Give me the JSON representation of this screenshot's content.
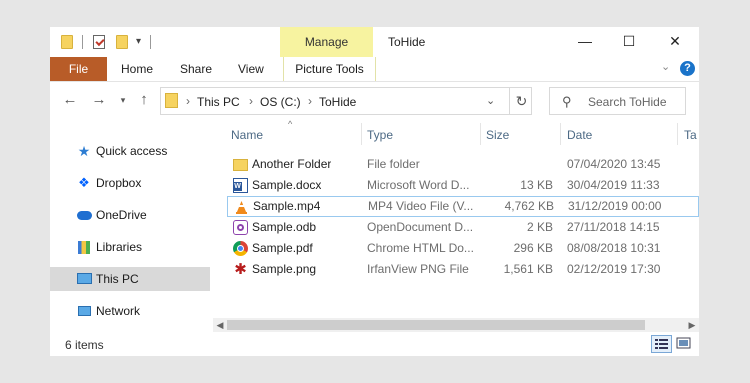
{
  "window": {
    "title": "ToHide"
  },
  "title_bar": {
    "manage_label": "Manage",
    "minimize": "—",
    "maximize": "☐",
    "close": "✕"
  },
  "ribbon": {
    "tabs": [
      {
        "label": "File"
      },
      {
        "label": "Home"
      },
      {
        "label": "Share"
      },
      {
        "label": "View"
      },
      {
        "label": "Picture Tools"
      }
    ],
    "help": "?"
  },
  "address": {
    "segments": [
      "This PC",
      "OS (C:)",
      "ToHide"
    ]
  },
  "search": {
    "placeholder": "Search ToHide"
  },
  "sidebar": {
    "items": [
      {
        "label": "Quick access"
      },
      {
        "label": "Dropbox"
      },
      {
        "label": "OneDrive"
      },
      {
        "label": "Libraries"
      },
      {
        "label": "This PC"
      },
      {
        "label": "Network"
      }
    ]
  },
  "columns": {
    "name": "Name",
    "type": "Type",
    "size": "Size",
    "date": "Date",
    "tags": "Ta"
  },
  "files": [
    {
      "name": "Another Folder",
      "type": "File folder",
      "size": "",
      "date": "07/04/2020 13:45"
    },
    {
      "name": "Sample.docx",
      "type": "Microsoft Word D...",
      "size": "13 KB",
      "date": "30/04/2019 11:33"
    },
    {
      "name": "Sample.mp4",
      "type": "MP4 Video File (V...",
      "size": "4,762 KB",
      "date": "31/12/2019 00:00"
    },
    {
      "name": "Sample.odb",
      "type": "OpenDocument D...",
      "size": "2 KB",
      "date": "27/11/2018 14:15"
    },
    {
      "name": "Sample.pdf",
      "type": "Chrome HTML Do...",
      "size": "296 KB",
      "date": "08/08/2018 10:31"
    },
    {
      "name": "Sample.png",
      "type": "IrfanView PNG File",
      "size": "1,561 KB",
      "date": "02/12/2019 17:30"
    }
  ],
  "status": {
    "item_count": "6 items"
  },
  "colors": {
    "file_tab": "#b85c28",
    "manage_highlight": "#f7f3a0",
    "selection_border": "#99c9ef",
    "header_text": "#4d6a85"
  }
}
